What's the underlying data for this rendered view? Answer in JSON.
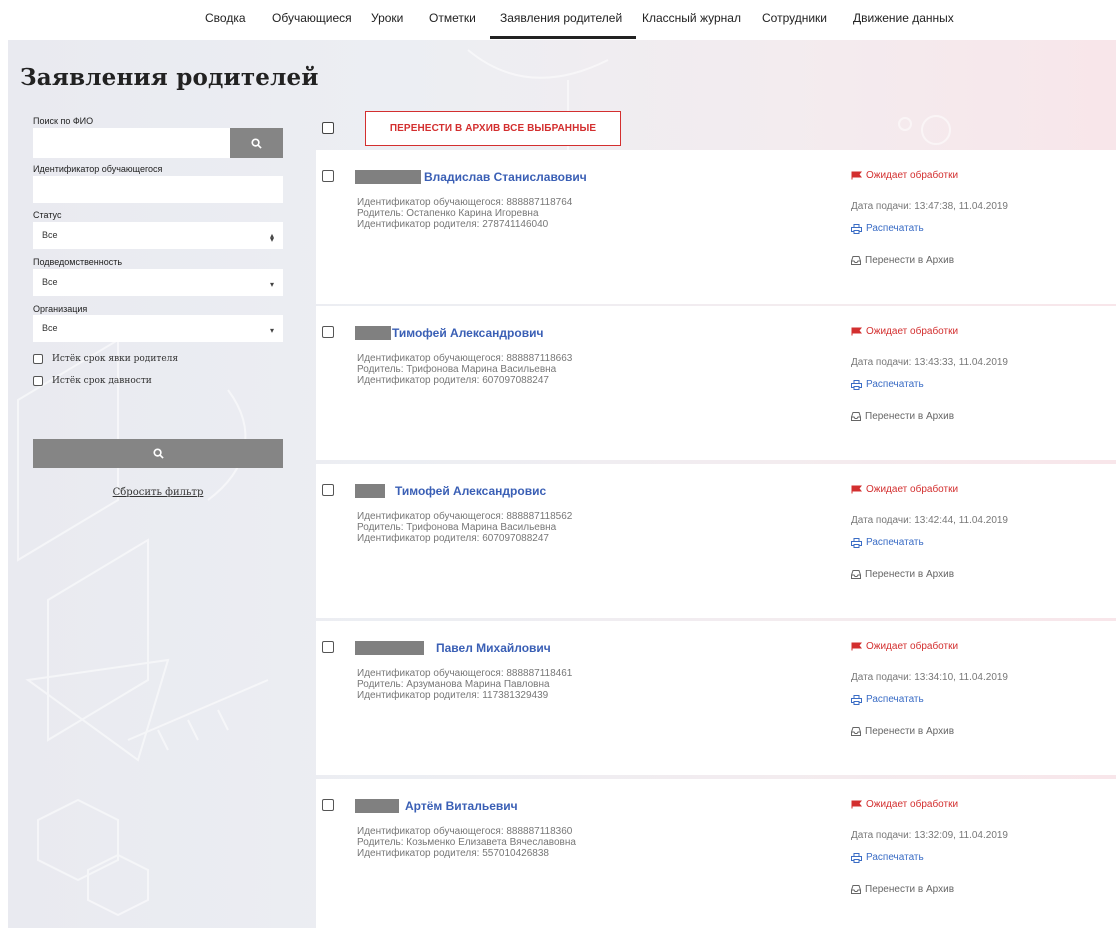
{
  "nav": {
    "tabs": [
      {
        "label": "Сводка"
      },
      {
        "label": "Обучающиеся"
      },
      {
        "label": "Уроки"
      },
      {
        "label": "Отметки"
      },
      {
        "label": "Заявления родителей",
        "active": true
      },
      {
        "label": "Классный журнал"
      },
      {
        "label": "Сотрудники"
      },
      {
        "label": "Движение данных"
      }
    ]
  },
  "page": {
    "title": "Заявления родителей"
  },
  "filters": {
    "search_label": "Поиск по ФИО",
    "search_value": "",
    "student_id_label": "Идентификатор обучающегося",
    "student_id_value": "",
    "status_label": "Статус",
    "status_value": "Все",
    "jurisdiction_label": "Подведомственность",
    "jurisdiction_value": "Все",
    "organization_label": "Организация",
    "organization_value": "Все",
    "check_parent_expired": "Истёк срок явки родителя",
    "check_limitation_expired": "Истёк срок давности",
    "reset_label": "Сбросить фильтр"
  },
  "toolbar": {
    "archive_all_label": "ПЕРЕНЕСТИ В АРХИВ ВСЕ ВЫБРАННЫЕ"
  },
  "applications": [
    {
      "name": "Владислав Станиславович",
      "student_id": "Идентификатор обучающегося: 888887118764",
      "parent": "Родитель: Остапенко Карина Игоревна",
      "parent_id": "Идентификатор родителя: 278741146040",
      "status": "Ожидает обработки",
      "date": "Дата подачи: 13:47:38, 11.04.2019",
      "print": "Распечатать",
      "archive": "Перенести в Архив"
    },
    {
      "name": "Тимофей Александрович",
      "student_id": "Идентификатор обучающегося: 888887118663",
      "parent": "Родитель: Трифонова Марина Васильевна",
      "parent_id": "Идентификатор родителя: 607097088247",
      "status": "Ожидает обработки",
      "date": "Дата подачи: 13:43:33, 11.04.2019",
      "print": "Распечатать",
      "archive": "Перенести в Архив"
    },
    {
      "name": "Тимофей Александровис",
      "student_id": "Идентификатор обучающегося: 888887118562",
      "parent": "Родитель: Трифонова Марина Васильевна",
      "parent_id": "Идентификатор родителя: 607097088247",
      "status": "Ожидает обработки",
      "date": "Дата подачи: 13:42:44, 11.04.2019",
      "print": "Распечатать",
      "archive": "Перенести в Архив"
    },
    {
      "name": "Павел Михайлович",
      "student_id": "Идентификатор обучающегося: 888887118461",
      "parent": "Родитель: Арзуманова Марина Павловна",
      "parent_id": "Идентификатор родителя: 117381329439",
      "status": "Ожидает обработки",
      "date": "Дата подачи: 13:34:10, 11.04.2019",
      "print": "Распечатать",
      "archive": "Перенести в Архив"
    },
    {
      "name": "Артём Витальевич",
      "student_id": "Идентификатор обучающегося: 888887118360",
      "parent": "Родитель: Козьменко Елизавета Вячеславовна",
      "parent_id": "Идентификатор родителя: 557010426838",
      "status": "Ожидает обработки",
      "date": "Дата подачи: 13:32:09, 11.04.2019",
      "print": "Распечатать",
      "archive": "Перенести в Архив"
    }
  ],
  "colors": {
    "accent": "#3a5fb5",
    "status_red": "#d32f2f",
    "button_gray": "#858585"
  },
  "icons": {
    "search": "search-icon",
    "flag": "flag-icon",
    "print": "printer-icon",
    "archive": "inbox-icon"
  }
}
